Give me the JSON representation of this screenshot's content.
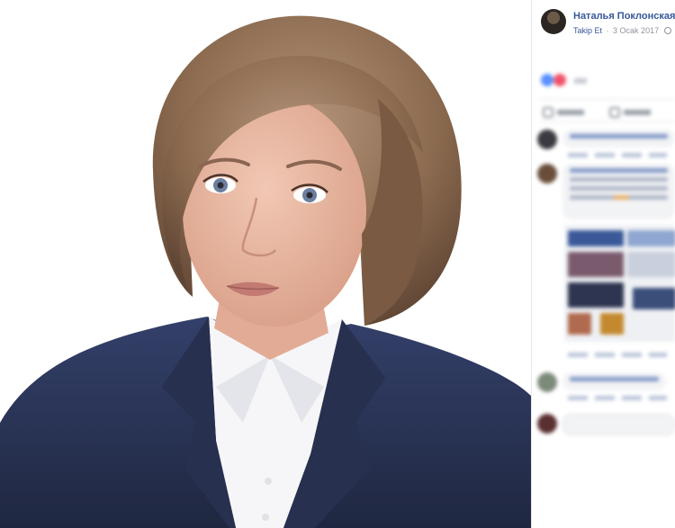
{
  "post": {
    "author_name": "Наталья Поклонская",
    "follow_label": "Takip Et",
    "separator": "·",
    "date": "3 Ocak 2017",
    "privacy_icon": "globe-icon"
  },
  "photo": {
    "alt_icon": "portrait-photo",
    "colors": {
      "hair": "#8b6a4f",
      "hair_highlight": "#b3937a",
      "skin": "#e8b9a4",
      "jacket": "#2c3757",
      "shirt": "#f6f6f8"
    }
  },
  "panel": {
    "link_color": "#385898",
    "meta_color": "#90949c",
    "reactions": [
      "like-icon",
      "love-icon"
    ]
  }
}
